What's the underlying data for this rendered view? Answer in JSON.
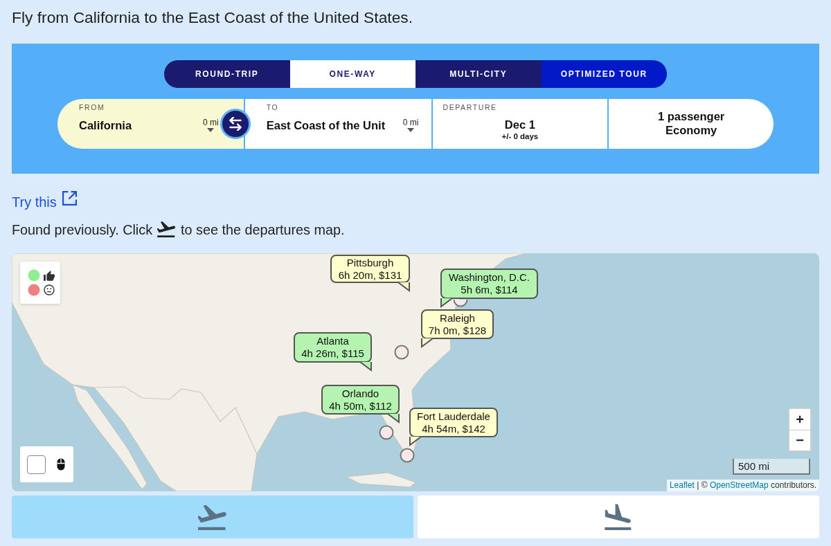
{
  "heading": "Fly from California to the East Coast of the United States.",
  "search": {
    "trip_types": [
      {
        "label": "ROUND-TRIP",
        "selected": false,
        "highlighted": false
      },
      {
        "label": "ONE-WAY",
        "selected": true,
        "highlighted": false
      },
      {
        "label": "MULTI-CITY",
        "selected": false,
        "highlighted": false
      },
      {
        "label": "OPTIMIZED TOUR",
        "selected": false,
        "highlighted": true
      }
    ],
    "fields": [
      {
        "kind": "place",
        "label": "FROM",
        "value": "California",
        "radius": "0 mi",
        "focused": true
      },
      {
        "kind": "place",
        "label": "TO",
        "value": "East Coast of the Unit",
        "radius": "0 mi",
        "focused": false
      },
      {
        "kind": "date",
        "label": "DEPARTURE",
        "value": "Dec 1",
        "flex": "+/- 0 days"
      },
      {
        "kind": "travelers",
        "passengers": "1 passenger",
        "cabin": "Economy"
      }
    ]
  },
  "try_link": "Try this",
  "note": {
    "before": "Found previously. Click",
    "after": "to see the departures map."
  },
  "map": {
    "legend": [
      {
        "kind": "liked",
        "color": "#90ee90"
      },
      {
        "kind": "neutral",
        "color": "#f08080"
      }
    ],
    "destinations": [
      {
        "city": "Pittsburgh",
        "summary": "6h 20m, $131",
        "color": "#ffffcc"
      },
      {
        "city": "Washington, D.C.",
        "summary": "5h 6m, $114",
        "color": "#b4f4b0"
      },
      {
        "city": "Raleigh",
        "summary": "7h 0m, $128",
        "color": "#ffffcc"
      },
      {
        "city": "Atlanta",
        "summary": "4h 26m, $115",
        "color": "#b4f4b0"
      },
      {
        "city": "Orlando",
        "summary": "4h 50m, $112",
        "color": "#b4f4b0"
      },
      {
        "city": "Fort Lauderdale",
        "summary": "4h 54m, $142",
        "color": "#ffffcc"
      }
    ],
    "scroll_zoom": {
      "checked": false
    },
    "zoom_in": "+",
    "zoom_out": "−",
    "scale": "500 mi",
    "attribution": [
      {
        "kind": "link",
        "text": "Leaflet"
      },
      {
        "kind": "text",
        "text": " | © "
      },
      {
        "kind": "link",
        "text": "OpenStreetMap"
      },
      {
        "kind": "text",
        "text": " contributors."
      }
    ]
  },
  "map_modes": [
    {
      "kind": "departures",
      "selected": true
    },
    {
      "kind": "arrivals",
      "selected": false
    }
  ]
}
